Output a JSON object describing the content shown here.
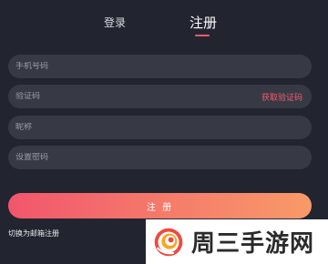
{
  "tabs": {
    "login_label": "登录",
    "register_label": "注册",
    "active": "register"
  },
  "form": {
    "phone_placeholder": "手机号码",
    "code_placeholder": "验证码",
    "get_code_label": "获取验证码",
    "nickname_placeholder": "昵称",
    "password_placeholder": "设置密码",
    "submit_label": "注 册"
  },
  "switch_link_label": "切换为邮箱注册",
  "watermark": {
    "text": "周三手游网",
    "logo_icon": "swirl-logo-icon"
  },
  "colors": {
    "background": "#222530",
    "input_background": "#373a45",
    "accent": "#f25b6c",
    "button_gradient_start": "#f1566c",
    "button_gradient_end": "#f89a68"
  }
}
